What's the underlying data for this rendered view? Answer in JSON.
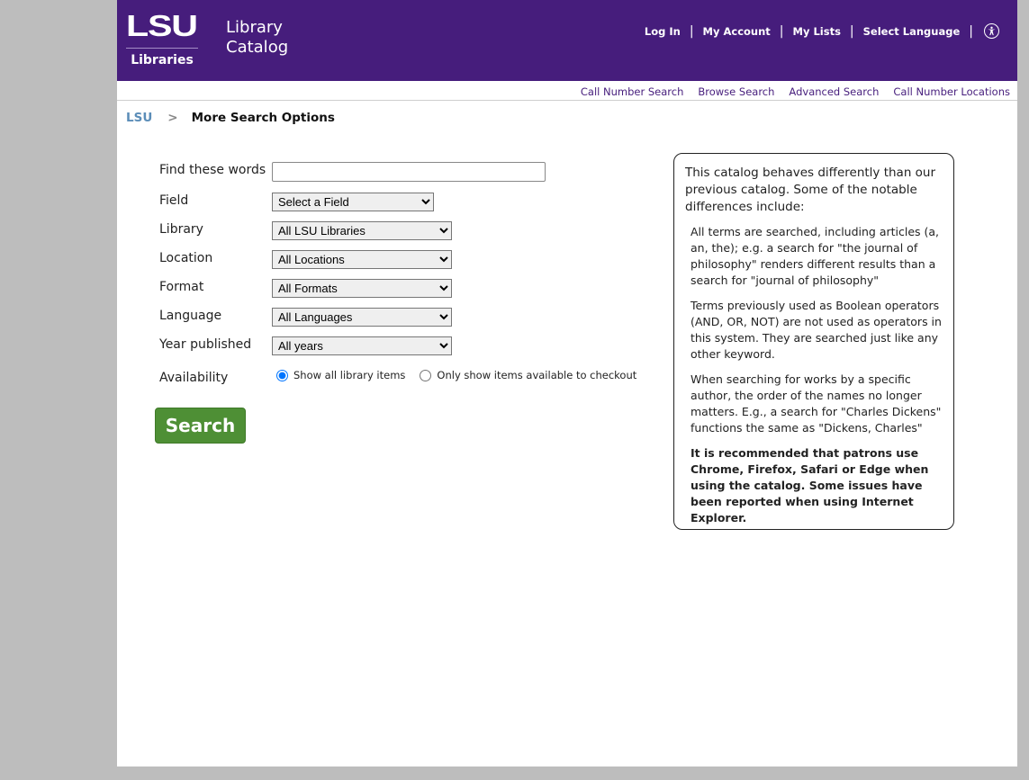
{
  "header": {
    "logo_main": "LSU",
    "logo_sub": "Libraries",
    "title_line1": "Library",
    "title_line2": "Catalog",
    "links": [
      "Log In",
      "My Account",
      "My Lists",
      "Select Language"
    ],
    "separator": "|",
    "accessibility_icon": "accessibility-icon",
    "background_color": "#461d7c"
  },
  "subnav": {
    "links": [
      "Call Number Search",
      "Browse Search",
      "Advanced Search",
      "Call Number Locations"
    ]
  },
  "breadcrumb": {
    "home": "LSU",
    "separator": ">",
    "current": "More Search Options"
  },
  "form": {
    "find_label": "Find these words",
    "find_value": "",
    "field_label": "Field",
    "field_value": "Select a Field",
    "library_label": "Library",
    "library_value": "All LSU Libraries",
    "location_label": "Location",
    "location_value": "All Locations",
    "format_label": "Format",
    "format_value": "All Formats",
    "language_label": "Language",
    "language_value": "All Languages",
    "year_label": "Year published",
    "year_value": "All years",
    "availability_label": "Availability",
    "availability_options": [
      "Show all library items",
      "Only show items available to checkout"
    ],
    "availability_selected": 0,
    "search_button": "Search",
    "search_button_color": "#4e8f35"
  },
  "notice": {
    "intro": "This catalog behaves differently than our previous catalog. Some of the notable differences include:",
    "items": [
      "All terms are searched, including articles (a, an, the); e.g. a search for \"the journal of philosophy\" renders different results than a search for \"journal of philosophy\"",
      "Terms previously used as Boolean operators (AND, OR, NOT) are not used as operators in this system. They are searched just like any other keyword.",
      "When searching for works by a specific author, the order of the names no longer matters. E.g., a search for \"Charles Dickens\" functions the same as \"Dickens, Charles\""
    ],
    "recommendation": "It is recommended that patrons use Chrome, Firefox, Safari or Edge when using the catalog. Some issues have been reported when using Internet Explorer."
  }
}
